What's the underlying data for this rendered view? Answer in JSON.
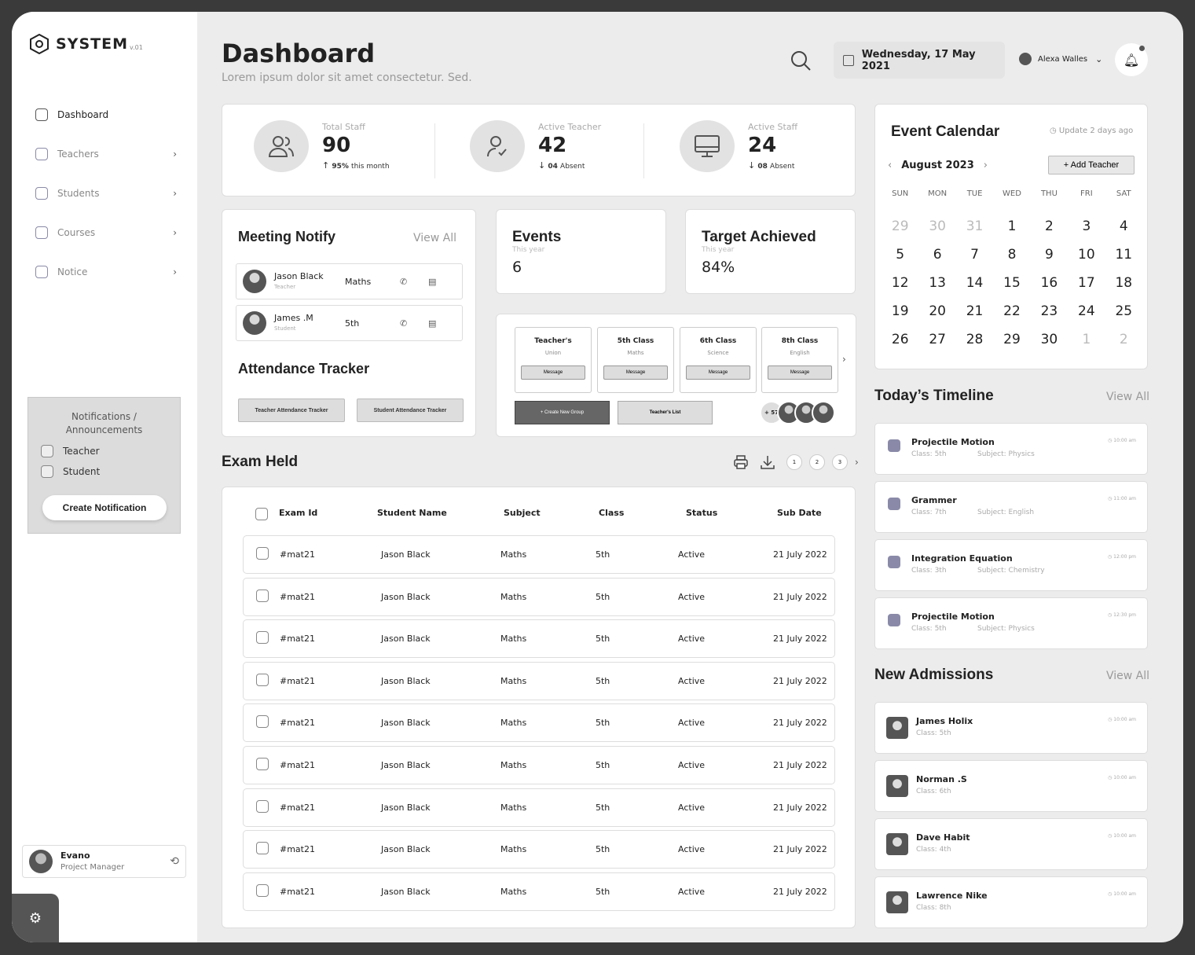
{
  "app": {
    "name": "SYSTEM",
    "version": "v.01"
  },
  "sidebar": {
    "items": [
      {
        "label": "Dashboard"
      },
      {
        "label": "Teachers"
      },
      {
        "label": "Students"
      },
      {
        "label": "Courses"
      },
      {
        "label": "Notice"
      }
    ],
    "notifications": {
      "title": "Notifications / Announcements",
      "options": [
        "Teacher",
        "Student"
      ],
      "create_label": "Create Notification"
    },
    "profile": {
      "name": "Evano",
      "role": "Project Manager"
    }
  },
  "header": {
    "title": "Dashboard",
    "subtitle": "Lorem ipsum dolor sit amet consectetur. Sed.",
    "date": "Wednesday, 17 May 2021",
    "user": "Alexa Walles"
  },
  "stats": [
    {
      "label": "Total Staff",
      "value": "90",
      "note_bold": "95%",
      "note": "this month",
      "trend": "up"
    },
    {
      "label": "Active Teacher",
      "value": "42",
      "note_bold": "04",
      "note": "Absent",
      "trend": "down"
    },
    {
      "label": "Active Staff",
      "value": "24",
      "note_bold": "08",
      "note": "Absent",
      "trend": "down"
    }
  ],
  "meeting": {
    "title": "Meeting Notify",
    "view_all": "View All",
    "rows": [
      {
        "name": "Jason Black",
        "role": "Teacher",
        "subject": "Maths"
      },
      {
        "name": "James .M",
        "role": "Student",
        "subject": "5th"
      }
    ]
  },
  "attendance": {
    "title": "Attendance Tracker",
    "buttons": [
      "Teacher Attendance Tracker",
      "Student Attendance Tracker"
    ]
  },
  "events": {
    "title": "Events",
    "sub": "This year",
    "value": "6"
  },
  "target": {
    "title": "Target Achieved",
    "sub": "This year",
    "value": "84%"
  },
  "groups": {
    "items": [
      {
        "title": "Teacher's",
        "sub": "Union",
        "btn": "Message"
      },
      {
        "title": "5th Class",
        "sub": "Maths",
        "btn": "Message"
      },
      {
        "title": "6th Class",
        "sub": "Science",
        "btn": "Message"
      },
      {
        "title": "8th Class",
        "sub": "English",
        "btn": "Message"
      }
    ],
    "create_label": "+ Create New Group",
    "list_label": "Teacher's List",
    "more_count": "+ 57"
  },
  "exam": {
    "title": "Exam Held",
    "pages": [
      "1",
      "2",
      "3"
    ],
    "columns": [
      "Exam Id",
      "Student Name",
      "Subject",
      "Class",
      "Status",
      "Sub Date"
    ],
    "rows": [
      [
        "#mat21",
        "Jason Black",
        "Maths",
        "5th",
        "Active",
        "21 July 2022"
      ],
      [
        "#mat21",
        "Jason Black",
        "Maths",
        "5th",
        "Active",
        "21 July 2022"
      ],
      [
        "#mat21",
        "Jason Black",
        "Maths",
        "5th",
        "Active",
        "21 July 2022"
      ],
      [
        "#mat21",
        "Jason Black",
        "Maths",
        "5th",
        "Active",
        "21 July 2022"
      ],
      [
        "#mat21",
        "Jason Black",
        "Maths",
        "5th",
        "Active",
        "21 July 2022"
      ],
      [
        "#mat21",
        "Jason Black",
        "Maths",
        "5th",
        "Active",
        "21 July 2022"
      ],
      [
        "#mat21",
        "Jason Black",
        "Maths",
        "5th",
        "Active",
        "21 July 2022"
      ],
      [
        "#mat21",
        "Jason Black",
        "Maths",
        "5th",
        "Active",
        "21 July 2022"
      ],
      [
        "#mat21",
        "Jason Black",
        "Maths",
        "5th",
        "Active",
        "21 July 2022"
      ]
    ]
  },
  "calendar": {
    "title": "Event Calendar",
    "update": "Update 2 days ago",
    "month": "August 2023",
    "add_label": "+ Add Teacher",
    "dow": [
      "SUN",
      "MON",
      "TUE",
      "WED",
      "THU",
      "FRI",
      "SAT"
    ],
    "weeks": [
      [
        "29",
        "30",
        "31",
        "1",
        "2",
        "3",
        "4"
      ],
      [
        "5",
        "6",
        "7",
        "8",
        "9",
        "10",
        "11"
      ],
      [
        "12",
        "13",
        "14",
        "15",
        "16",
        "17",
        "18"
      ],
      [
        "19",
        "20",
        "21",
        "22",
        "23",
        "24",
        "25"
      ],
      [
        "26",
        "27",
        "28",
        "29",
        "30",
        "1",
        "2"
      ]
    ]
  },
  "timeline": {
    "title": "Today’s Timeline",
    "view_all": "View All",
    "items": [
      {
        "name": "Projectile Motion",
        "class": "Class: 5th",
        "subject": "Subject: Physics",
        "time": "10:00 am"
      },
      {
        "name": "Grammer",
        "class": "Class: 7th",
        "subject": "Subject: English",
        "time": "11:00 am"
      },
      {
        "name": "Integration Equation",
        "class": "Class: 3th",
        "subject": "Subject: Chemistry",
        "time": "12:00 pm"
      },
      {
        "name": "Projectile Motion",
        "class": "Class: 5th",
        "subject": "Subject: Physics",
        "time": "12:30 pm"
      }
    ]
  },
  "admissions": {
    "title": "New Admissions",
    "view_all": "View All",
    "items": [
      {
        "name": "James Holix",
        "class": "Class: 5th",
        "time": "10:00 am"
      },
      {
        "name": "Norman .S",
        "class": "Class: 6th",
        "time": "10:00 am"
      },
      {
        "name": "Dave Habit",
        "class": "Class: 4th",
        "time": "10:00 am"
      },
      {
        "name": "Lawrence Nike",
        "class": "Class: 8th",
        "time": "10:00 am"
      }
    ]
  },
  "colors": {
    "accent": "#8a8aa8",
    "dark": "#555555",
    "frame": "#3a3a3a"
  }
}
